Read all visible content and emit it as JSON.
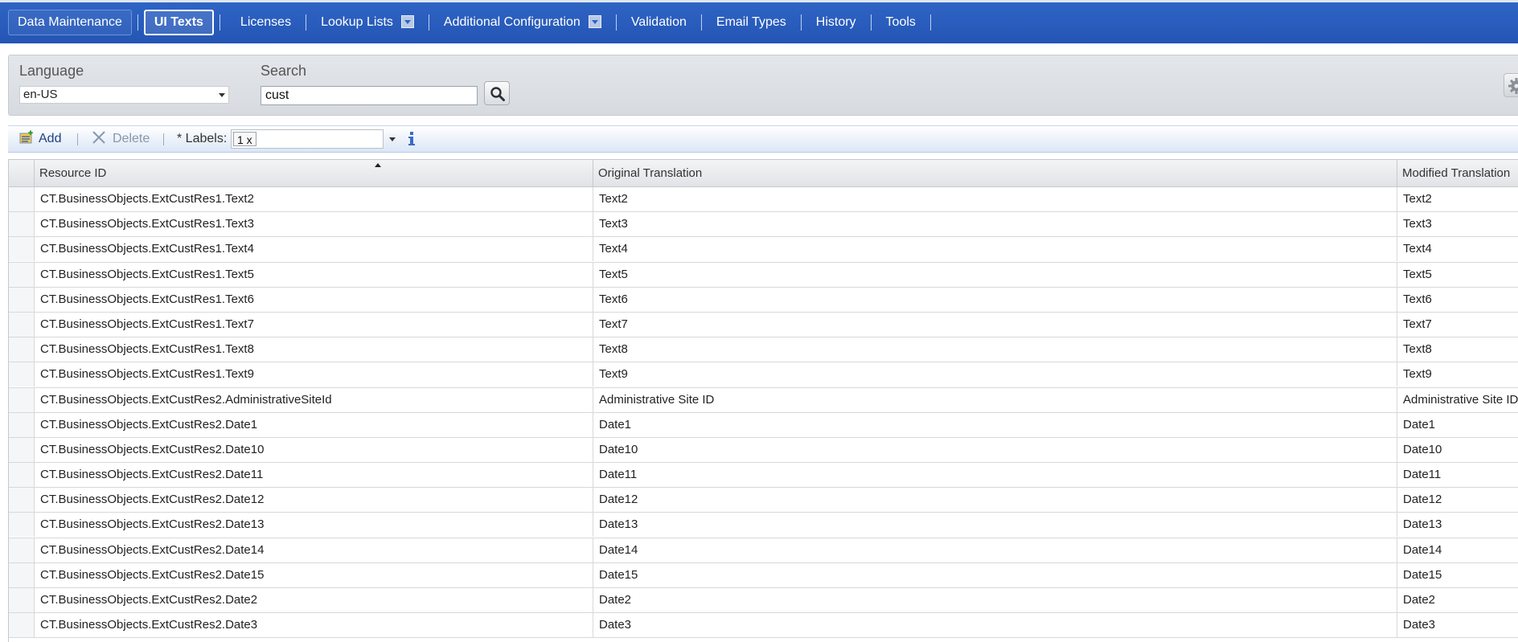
{
  "nav": {
    "items": [
      {
        "label": "Data Maintenance",
        "style": "button"
      },
      {
        "label": "UI Texts",
        "style": "active"
      },
      {
        "label": "Licenses",
        "style": "link"
      },
      {
        "label": "Lookup Lists",
        "style": "link",
        "dropdown": true
      },
      {
        "label": "Additional Configuration",
        "style": "link",
        "dropdown": true
      },
      {
        "label": "Validation",
        "style": "link"
      },
      {
        "label": "Email Types",
        "style": "link"
      },
      {
        "label": "History",
        "style": "link"
      },
      {
        "label": "Tools",
        "style": "link"
      }
    ]
  },
  "filters": {
    "language_label": "Language",
    "language_value": "en-US",
    "search_label": "Search",
    "search_value": "cust"
  },
  "toolbar": {
    "add_label": "Add",
    "delete_label": "Delete",
    "labels_label": "* Labels:",
    "labels_chip": "1 x"
  },
  "grid": {
    "columns": [
      "",
      "Resource ID",
      "Original Translation",
      "Modified Translation"
    ],
    "sorted_column": "Resource ID",
    "rows": [
      [
        "CT.BusinessObjects.ExtCustRes1.Text2",
        "Text2",
        "Text2"
      ],
      [
        "CT.BusinessObjects.ExtCustRes1.Text3",
        "Text3",
        "Text3"
      ],
      [
        "CT.BusinessObjects.ExtCustRes1.Text4",
        "Text4",
        "Text4"
      ],
      [
        "CT.BusinessObjects.ExtCustRes1.Text5",
        "Text5",
        "Text5"
      ],
      [
        "CT.BusinessObjects.ExtCustRes1.Text6",
        "Text6",
        "Text6"
      ],
      [
        "CT.BusinessObjects.ExtCustRes1.Text7",
        "Text7",
        "Text7"
      ],
      [
        "CT.BusinessObjects.ExtCustRes1.Text8",
        "Text8",
        "Text8"
      ],
      [
        "CT.BusinessObjects.ExtCustRes1.Text9",
        "Text9",
        "Text9"
      ],
      [
        "CT.BusinessObjects.ExtCustRes2.AdministrativeSiteId",
        "Administrative Site ID",
        "Administrative Site ID"
      ],
      [
        "CT.BusinessObjects.ExtCustRes2.Date1",
        "Date1",
        "Date1"
      ],
      [
        "CT.BusinessObjects.ExtCustRes2.Date10",
        "Date10",
        "Date10"
      ],
      [
        "CT.BusinessObjects.ExtCustRes2.Date11",
        "Date11",
        "Date11"
      ],
      [
        "CT.BusinessObjects.ExtCustRes2.Date12",
        "Date12",
        "Date12"
      ],
      [
        "CT.BusinessObjects.ExtCustRes2.Date13",
        "Date13",
        "Date13"
      ],
      [
        "CT.BusinessObjects.ExtCustRes2.Date14",
        "Date14",
        "Date14"
      ],
      [
        "CT.BusinessObjects.ExtCustRes2.Date15",
        "Date15",
        "Date15"
      ],
      [
        "CT.BusinessObjects.ExtCustRes2.Date2",
        "Date2",
        "Date2"
      ],
      [
        "CT.BusinessObjects.ExtCustRes2.Date3",
        "Date3",
        "Date3"
      ]
    ]
  },
  "icons": {
    "add": "add-icon",
    "delete": "delete-icon",
    "search": "search-icon",
    "settings": "gear-icon",
    "info": "info-icon"
  },
  "colors": {
    "nav_background": "#2f64c4",
    "toolbar_text": "#1f3f86"
  }
}
